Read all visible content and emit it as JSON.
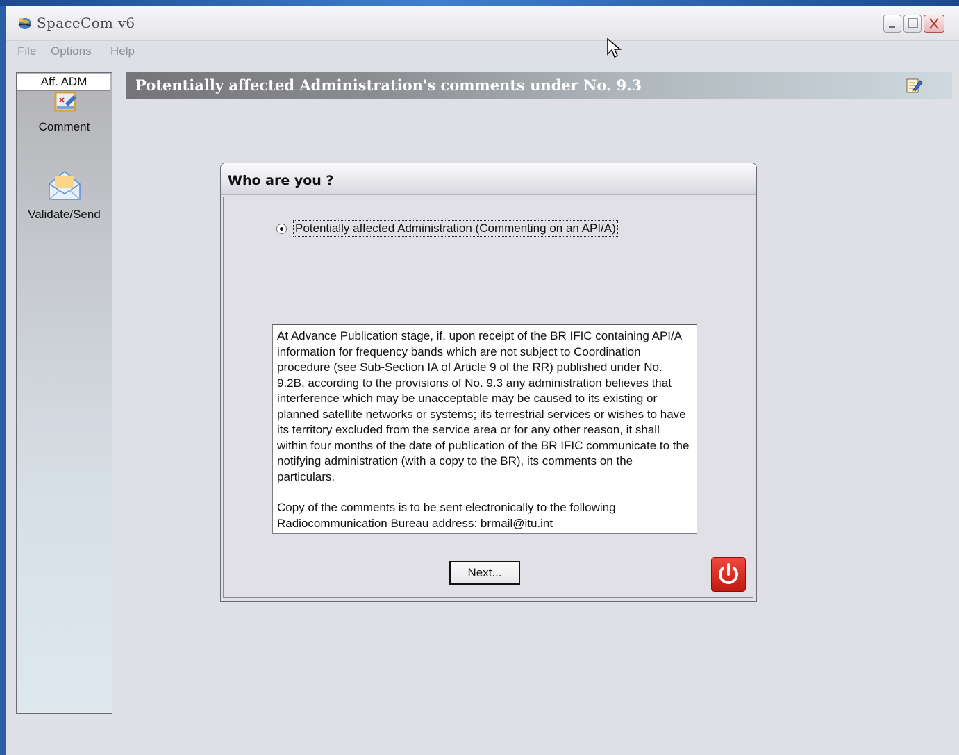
{
  "window": {
    "title": "SpaceCom v6"
  },
  "menu": {
    "items": [
      "File",
      "Options",
      "Help"
    ]
  },
  "sidebar": {
    "header": "Aff. ADM",
    "items": [
      {
        "label": "Comment",
        "icon": "comment-icon"
      },
      {
        "label": "Validate/Send",
        "icon": "envelope-icon"
      }
    ]
  },
  "banner": {
    "title": "Potentially affected Administration's comments under No. 9.3",
    "icon": "edit-icon"
  },
  "dialog": {
    "title": "Who are you ?",
    "radio_label": "Potentially affected Administration (Commenting on an API/A)",
    "radio_selected": true,
    "info_paragraph_1": "At Advance Publication stage, if, upon receipt of the BR IFIC containing API/A information for frequency bands which are not subject to Coordination procedure (see Sub-Section IA of Article 9 of the RR) published under No. 9.2B, according to the provisions of No. 9.3 any administration believes that interference which may be unacceptable may be caused to its existing or planned satellite networks or systems; its terrestrial services or wishes to have its territory excluded from the service area or for any other reason, it shall within four months of the date of publication of the BR IFIC communicate to the notifying administration (with a copy to the BR), its comments on the particulars.",
    "info_paragraph_2": "Copy of the comments is to be sent electronically to the following Radiocommunication Bureau address: brmail@itu.int",
    "next_label": "Next...",
    "exit_icon": "power-icon"
  },
  "colors": {
    "desktop": "#2a5fa8",
    "window_bg": "#dfdfe6",
    "exit_red": "#d9231a"
  }
}
